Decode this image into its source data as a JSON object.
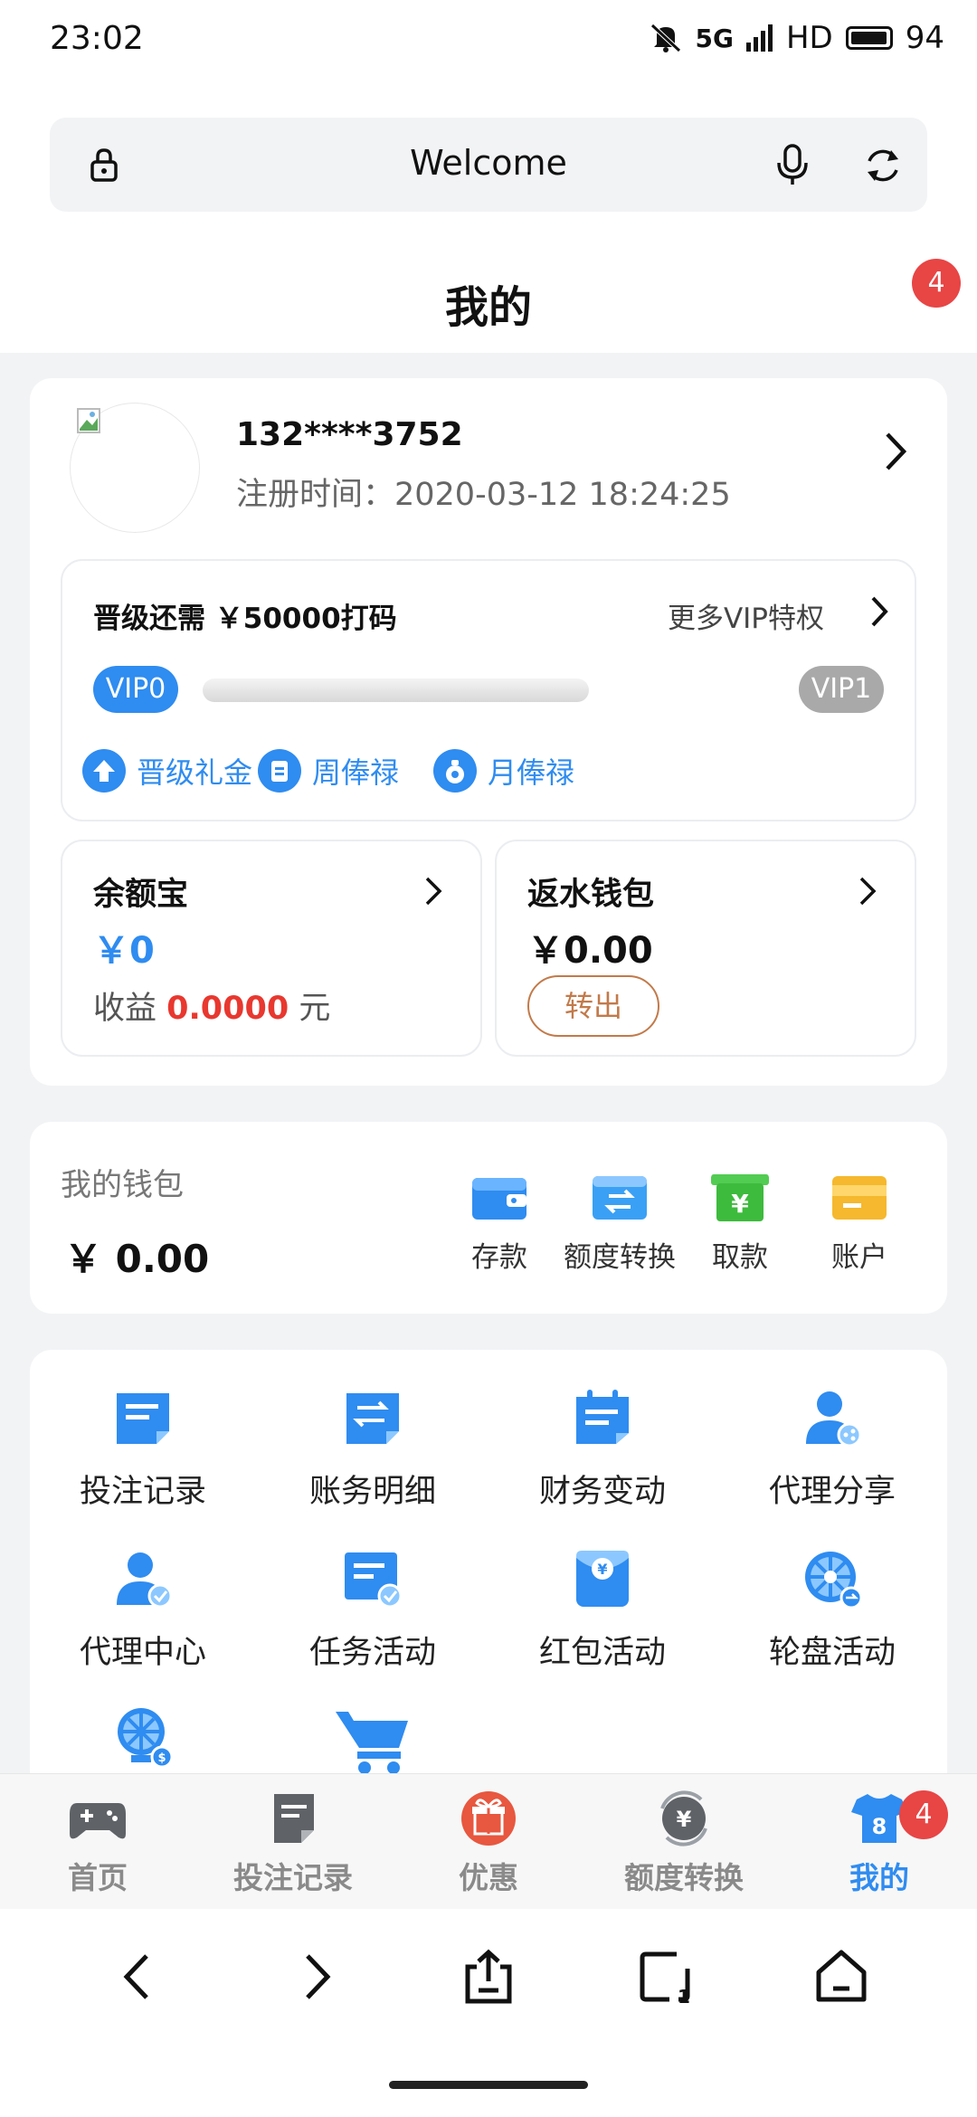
{
  "status_bar": {
    "time": "23:02",
    "network": "5G",
    "hd": "HD",
    "battery": "94"
  },
  "browser": {
    "title": "Welcome"
  },
  "header": {
    "title": "我的",
    "badge": "4"
  },
  "profile": {
    "phone": "132****3752",
    "register_time": "注册时间：2020-03-12 18:24:25"
  },
  "vip": {
    "upgrade_need": "晋级还需 ￥50000打码",
    "more_link": "更多VIP特权",
    "current_level": "VIP0",
    "next_level": "VIP1",
    "progress_percent": 0,
    "perks": [
      "晋级礼金",
      "周俸禄",
      "月俸禄"
    ]
  },
  "yuebao": {
    "title": "余额宝",
    "amount": "￥0",
    "earn_label": "收益",
    "earn_value": "0.0000",
    "earn_unit": "元"
  },
  "rebate": {
    "title": "返水钱包",
    "amount": "￥0.00",
    "out_button": "转出"
  },
  "wallet": {
    "label": "我的钱包",
    "balance": "￥ 0.00",
    "actions": [
      {
        "label": "存款",
        "icon": "deposit-wallet-icon",
        "color": "#2f8cf0"
      },
      {
        "label": "额度转换",
        "icon": "transfer-card-icon",
        "color": "#3aa0f5"
      },
      {
        "label": "取款",
        "icon": "withdraw-box-icon",
        "color": "#3dbb3d"
      },
      {
        "label": "账户",
        "icon": "account-card-icon",
        "color": "#f5b82e"
      }
    ]
  },
  "features": [
    {
      "label": "投注记录",
      "icon": "bet-record-icon"
    },
    {
      "label": "账务明细",
      "icon": "account-detail-icon"
    },
    {
      "label": "财务变动",
      "icon": "finance-change-icon"
    },
    {
      "label": "代理分享",
      "icon": "agent-share-icon"
    },
    {
      "label": "代理中心",
      "icon": "agent-center-icon"
    },
    {
      "label": "任务活动",
      "icon": "task-activity-icon"
    },
    {
      "label": "红包活动",
      "icon": "red-packet-icon"
    },
    {
      "label": "轮盘活动",
      "icon": "roulette-icon"
    },
    {
      "label": "",
      "icon": "wheel-money-icon"
    },
    {
      "label": "",
      "icon": "shopping-cart-icon"
    }
  ],
  "bottom_nav": [
    {
      "label": "首页",
      "icon": "gamepad-icon"
    },
    {
      "label": "投注记录",
      "icon": "note-icon"
    },
    {
      "label": "优惠",
      "icon": "gift-icon"
    },
    {
      "label": "额度转换",
      "icon": "yen-exchange-icon"
    },
    {
      "label": "我的",
      "icon": "jersey-icon",
      "badge": "4",
      "jersey_number": "8"
    }
  ],
  "colors": {
    "accent": "#2f8cf0",
    "danger": "#e8382f",
    "badge": "#e84545"
  }
}
